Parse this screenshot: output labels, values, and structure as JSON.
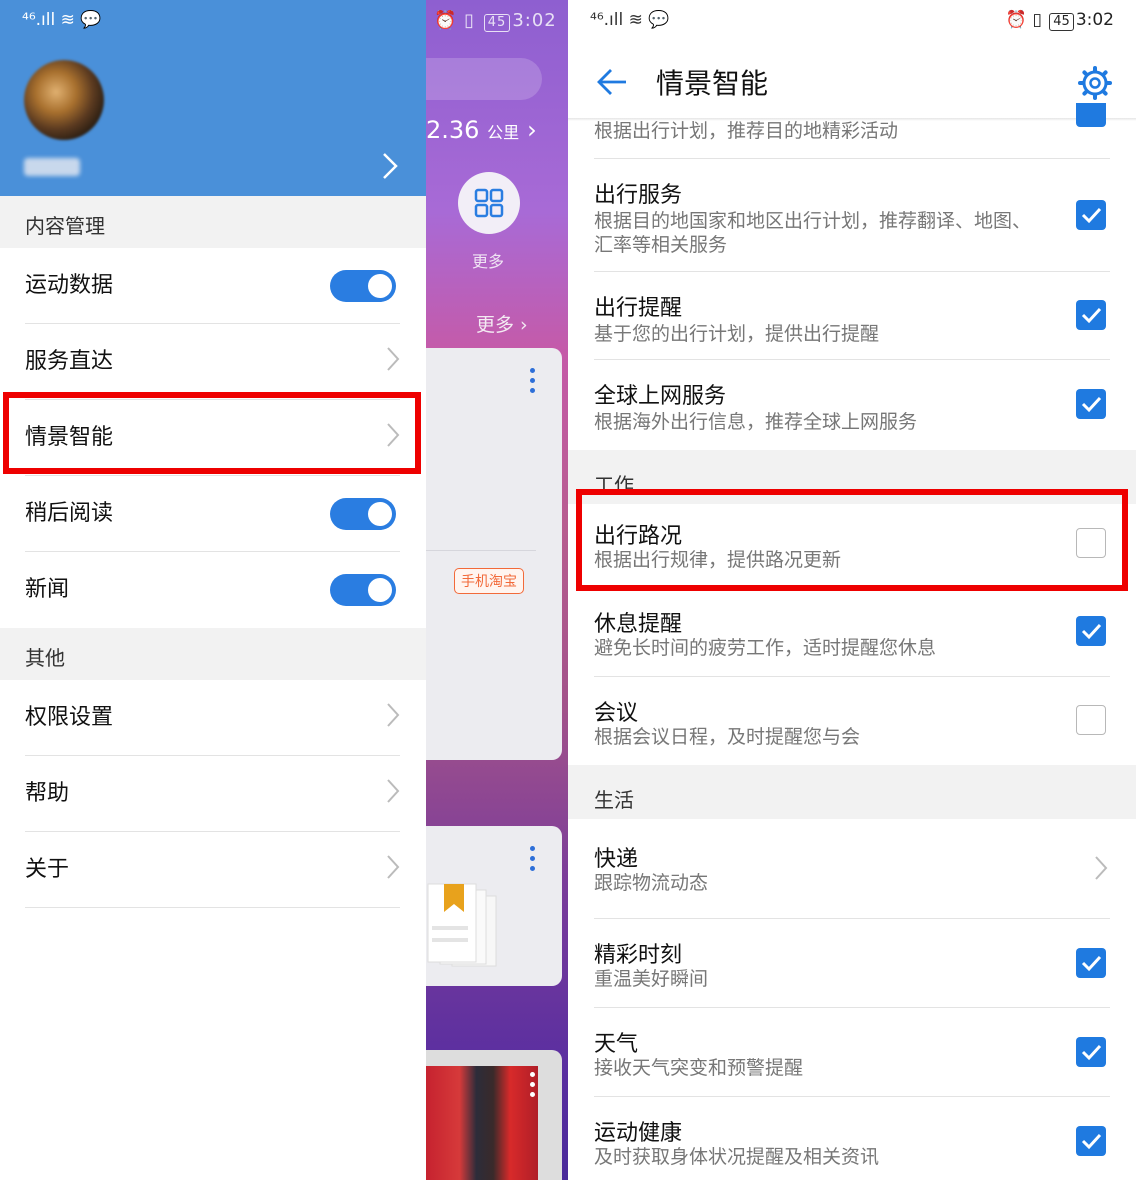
{
  "left": {
    "status_bar": {
      "network": "⁴⁶.ıll"
    },
    "background_app": {
      "status_time": "3:02",
      "battery": "45",
      "distance_value": "2.36",
      "distance_unit": "公里",
      "more_label": "更多",
      "more_link": "更多",
      "tag": "手机淘宝"
    },
    "drawer": {
      "sections": [
        {
          "title": "内容管理"
        },
        {
          "title": "其他"
        }
      ],
      "items": [
        {
          "label": "运动数据",
          "control": "toggle",
          "on": true
        },
        {
          "label": "服务直达",
          "control": "chevron"
        },
        {
          "label": "情景智能",
          "control": "chevron",
          "highlighted": true
        },
        {
          "label": "稍后阅读",
          "control": "toggle",
          "on": true
        },
        {
          "label": "新闻",
          "control": "toggle",
          "on": true
        },
        {
          "label": "权限设置",
          "control": "chevron"
        },
        {
          "label": "帮助",
          "control": "chevron"
        },
        {
          "label": "关于",
          "control": "chevron"
        }
      ]
    }
  },
  "right": {
    "status_bar": {
      "network": "⁴⁶.ıll",
      "battery": "45",
      "time": "3:02"
    },
    "title": "情景智能",
    "partial_row": {
      "desc": "根据出行计划，推荐目的地精彩活动"
    },
    "rows": [
      {
        "title": "出行服务",
        "desc": "根据目的地国家和地区出行计划，推荐翻译、地图、汇率等相关服务",
        "checked": true
      },
      {
        "title": "出行提醒",
        "desc": "基于您的出行计划，提供出行提醒",
        "checked": true
      },
      {
        "title": "全球上网服务",
        "desc": "根据海外出行信息，推荐全球上网服务",
        "checked": true
      }
    ],
    "section_work": "工作",
    "work_rows": [
      {
        "title": "出行路况",
        "desc": "根据出行规律，提供路况更新",
        "checked": false,
        "highlighted": true
      },
      {
        "title": "休息提醒",
        "desc": "避免长时间的疲劳工作，适时提醒您休息",
        "checked": true
      },
      {
        "title": "会议",
        "desc": "根据会议日程，及时提醒您与会",
        "checked": false
      }
    ],
    "section_life": "生活",
    "life_rows": [
      {
        "title": "快递",
        "desc": "跟踪物流动态",
        "control": "chevron"
      },
      {
        "title": "精彩时刻",
        "desc": "重温美好瞬间",
        "checked": true
      },
      {
        "title": "天气",
        "desc": "接收天气突变和预警提醒",
        "checked": true
      },
      {
        "title": "运动健康",
        "desc": "及时获取身体状况提醒及相关资讯",
        "checked": true
      }
    ],
    "colors": {
      "accent": "#1f7ae0",
      "highlight": "#ee0000",
      "drawer_header": "#4a90d9"
    }
  }
}
